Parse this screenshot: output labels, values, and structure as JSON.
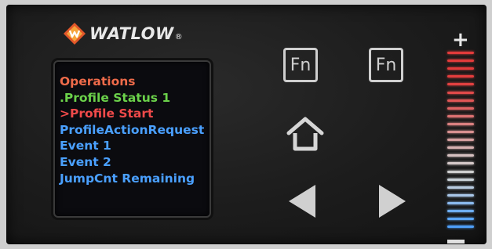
{
  "brand": {
    "name": "WATLOW",
    "registered": "®"
  },
  "screen": {
    "lines": [
      {
        "text": "Operations",
        "color": "#ef6b4a"
      },
      {
        "text": ".Profile Status 1",
        "color": "#6bd14a"
      },
      {
        "text": ">Profile Start",
        "color": "#f04a4a"
      },
      {
        "text": "ProfileActionRequest",
        "color": "#4aa0ff"
      },
      {
        "text": "Event 1",
        "color": "#4aa0ff"
      },
      {
        "text": "Event 2",
        "color": "#4aa0ff"
      },
      {
        "text": "JumpCnt Remaining",
        "color": "#4aa0ff"
      }
    ]
  },
  "keys": {
    "fn_left": "Fn",
    "fn_right": "Fn"
  },
  "bargraph": {
    "plus": "+",
    "colors": [
      "#e23b3b",
      "#e23b3b",
      "#e23b3b",
      "#e33d3d",
      "#e24141",
      "#e14a4a",
      "#e05656",
      "#de6363",
      "#dc7171",
      "#da8080",
      "#d89090",
      "#d7a0a0",
      "#d6b0b0",
      "#d5c0c0",
      "#d4c8c8",
      "#cfcfcf",
      "#c8d0d6",
      "#b8cbe0",
      "#a8c5e6",
      "#8ab9ee",
      "#6eaef2",
      "#5aa5f5",
      "#4e9ef7"
    ]
  }
}
